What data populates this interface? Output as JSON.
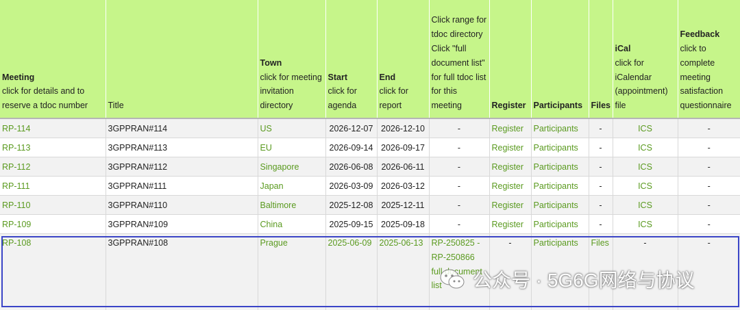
{
  "columns": {
    "meeting": {
      "title": "Meeting",
      "sub": "click for details and to reserve a tdoc number"
    },
    "title": {
      "title": "Title"
    },
    "town": {
      "title": "Town",
      "sub": "click for meeting invitation directory"
    },
    "start": {
      "title": "Start",
      "sub": "click for agenda"
    },
    "end": {
      "title": "End",
      "sub": "click for report"
    },
    "tdoc": {
      "sub": "Click range for tdoc directory Click \"full document list\" for full tdoc list for this meeting"
    },
    "register": {
      "title": "Register"
    },
    "participants": {
      "title": "Participants"
    },
    "files": {
      "title": "Files"
    },
    "ical": {
      "title": "iCal",
      "sub": "click for iCalendar (appointment) file"
    },
    "feedback": {
      "title": "Feedback",
      "sub": "click to complete meeting satisfaction questionnaire"
    }
  },
  "rows": [
    {
      "meeting": "RP-114",
      "title": "3GPPRAN#114",
      "town": "US",
      "start": "2026-12-07",
      "end": "2026-12-10",
      "tdoc": "-",
      "register": "Register",
      "participants": "Participants",
      "files": "-",
      "ical": "ICS",
      "feedback": "-"
    },
    {
      "meeting": "RP-113",
      "title": "3GPPRAN#113",
      "town": "EU",
      "start": "2026-09-14",
      "end": "2026-09-17",
      "tdoc": "-",
      "register": "Register",
      "participants": "Participants",
      "files": "-",
      "ical": "ICS",
      "feedback": "-"
    },
    {
      "meeting": "RP-112",
      "title": "3GPPRAN#112",
      "town": "Singapore",
      "start": "2026-06-08",
      "end": "2026-06-11",
      "tdoc": "-",
      "register": "Register",
      "participants": "Participants",
      "files": "-",
      "ical": "ICS",
      "feedback": "-"
    },
    {
      "meeting": "RP-111",
      "title": "3GPPRAN#111",
      "town": "Japan",
      "start": "2026-03-09",
      "end": "2026-03-12",
      "tdoc": "-",
      "register": "Register",
      "participants": "Participants",
      "files": "-",
      "ical": "ICS",
      "feedback": "-"
    },
    {
      "meeting": "RP-110",
      "title": "3GPPRAN#110",
      "town": "Baltimore",
      "start": "2025-12-08",
      "end": "2025-12-11",
      "tdoc": "-",
      "register": "Register",
      "participants": "Participants",
      "files": "-",
      "ical": "ICS",
      "feedback": "-"
    },
    {
      "meeting": "RP-109",
      "title": "3GPPRAN#109",
      "town": "China",
      "start": "2025-09-15",
      "end": "2025-09-18",
      "tdoc": "-",
      "register": "Register",
      "participants": "Participants",
      "files": "-",
      "ical": "ICS",
      "feedback": "-"
    }
  ],
  "highlighted_row": {
    "meeting": "RP-108",
    "title": "3GPPRAN#108",
    "town": "Prague",
    "start": "2025-06-09",
    "end": "2025-06-13",
    "tdoc_range": "RP-250825 - RP-250866",
    "tdoc_full_list": "full document list",
    "register": "-",
    "participants": "Participants",
    "files": "Files",
    "ical": "-",
    "feedback": "-"
  },
  "watermark": {
    "text": "公众号 · 5G6G网络与协议",
    "icon": "wechat-icon"
  },
  "colors": {
    "header_bg": "#c6f58a",
    "link": "#5a9a1f",
    "highlight_border": "#3a44c7"
  }
}
